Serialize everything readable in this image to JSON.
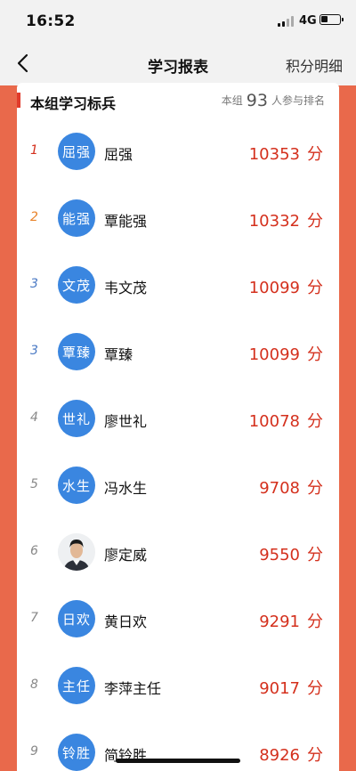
{
  "status": {
    "time": "16:52",
    "network": "4G"
  },
  "nav": {
    "title": "学习报表",
    "right_label": "积分明细"
  },
  "section": {
    "title": "本组学习标兵",
    "summary_prefix": "本组",
    "participants": "93",
    "summary_suffix": "人参与排名"
  },
  "score_unit": "分",
  "ranking": [
    {
      "rank": "1",
      "avatar_text": "屈强",
      "name": "屈强",
      "score": "10353",
      "rank_color": "#d4301d"
    },
    {
      "rank": "2",
      "avatar_text": "能强",
      "name": "覃能强",
      "score": "10332",
      "rank_color": "#e8832a"
    },
    {
      "rank": "3",
      "avatar_text": "文茂",
      "name": "韦文茂",
      "score": "10099",
      "rank_color": "#4a79c4"
    },
    {
      "rank": "3",
      "avatar_text": "覃臻",
      "name": "覃臻",
      "score": "10099",
      "rank_color": "#4a79c4"
    },
    {
      "rank": "4",
      "avatar_text": "世礼",
      "name": "廖世礼",
      "score": "10078",
      "rank_color": "#888888"
    },
    {
      "rank": "5",
      "avatar_text": "水生",
      "name": "冯水生",
      "score": "9708",
      "rank_color": "#888888"
    },
    {
      "rank": "6",
      "avatar_text": "",
      "name": "廖定威",
      "score": "9550",
      "rank_color": "#888888",
      "photo": true
    },
    {
      "rank": "7",
      "avatar_text": "日欢",
      "name": "黄日欢",
      "score": "9291",
      "rank_color": "#888888"
    },
    {
      "rank": "8",
      "avatar_text": "主任",
      "name": "李萍主任",
      "score": "9017",
      "rank_color": "#888888"
    },
    {
      "rank": "9",
      "avatar_text": "铃胜",
      "name": "简铃胜",
      "score": "8926",
      "rank_color": "#888888"
    }
  ],
  "colors": {
    "accent": "#d4301d",
    "avatar_bg": "#3a86e0",
    "page_bg": "#e9694b"
  },
  "icons": {
    "back": "chevron-left-icon",
    "signal": "signal-bars-icon",
    "battery": "battery-icon"
  }
}
